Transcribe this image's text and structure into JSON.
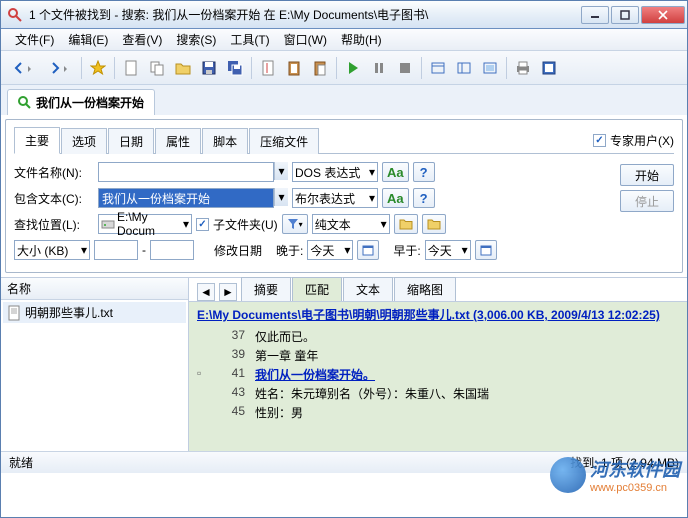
{
  "window": {
    "title": "1 个文件被找到 - 搜索: 我们从一份档案开始 在 E:\\My Documents\\电子图书\\"
  },
  "menu": {
    "file": "文件(F)",
    "edit": "编辑(E)",
    "view": "查看(V)",
    "search": "搜索(S)",
    "tools": "工具(T)",
    "window": "窗口(W)",
    "help": "帮助(H)"
  },
  "tab": {
    "label": "我们从一份档案开始"
  },
  "sp_tabs": {
    "main": "主要",
    "options": "选项",
    "date": "日期",
    "attr": "属性",
    "script": "脚本",
    "archive": "压缩文件"
  },
  "expert": {
    "label": "专家用户(X)"
  },
  "buttons": {
    "start": "开始",
    "stop": "停止"
  },
  "fields": {
    "filename_label": "文件名称(N):",
    "filename_value": "",
    "contains_label": "包含文本(C):",
    "contains_value": "我们从一份档案开始",
    "lookin_label": "查找位置(L):",
    "lookin_value": "E:\\My Docum",
    "subfolders_label": "子文件夹(U)",
    "size_label": "大小 (KB)",
    "moddate_label": "修改日期",
    "after_label": "晚于:",
    "after_value": "今天",
    "before_label": "早于:",
    "before_value": "今天",
    "expr1": "DOS 表达式",
    "expr2": "布尔表达式",
    "texttype": "纯文本"
  },
  "left": {
    "header": "名称",
    "file": "明朝那些事儿.txt"
  },
  "rtabs": {
    "summary": "摘要",
    "match": "匹配",
    "text": "文本",
    "thumb": "缩略图"
  },
  "result": {
    "path": "E:\\My Documents\\电子图书\\明朝\\明朝那些事儿.txt  (3,006.00 KB,  2009/4/13 12:02:25)",
    "lines": [
      {
        "n": "37",
        "t": "仅此而已。",
        "hl": false
      },
      {
        "n": "39",
        "t": "第一章 童年",
        "hl": false
      },
      {
        "n": "41",
        "t": "我们从一份档案开始。",
        "hl": true
      },
      {
        "n": "43",
        "t": "姓名：朱元璋别名（外号）：朱重八、朱国瑞",
        "hl": false
      },
      {
        "n": "45",
        "t": "性别：男",
        "hl": false
      }
    ]
  },
  "status": {
    "left": "就绪",
    "right": "找到: 1 项 (2.94 MB)"
  },
  "watermark": {
    "name": "河东软件园",
    "url": "www.pc0359.cn"
  }
}
